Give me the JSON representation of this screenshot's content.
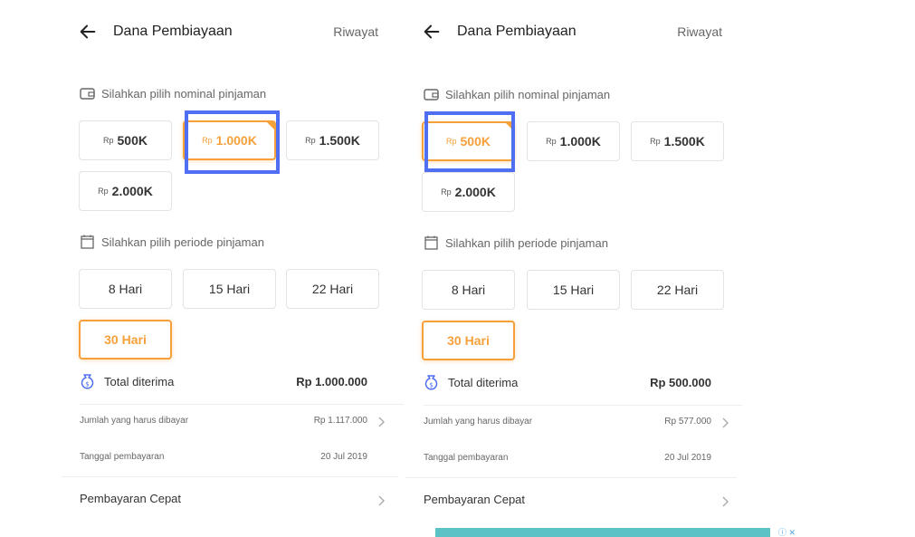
{
  "left": {
    "header": {
      "title": "Dana Pembiayaan",
      "history": "Riwayat"
    },
    "amount_label": "Silahkan pilih nominal pinjaman",
    "currency_prefix": "Rp",
    "amounts": [
      "500K",
      "1.000K",
      "1.500K",
      "2.000K"
    ],
    "selected_amount": "1.000K",
    "period_label": "Silahkan pilih periode pinjaman",
    "periods": [
      "8 Hari",
      "15 Hari",
      "22 Hari",
      "30 Hari"
    ],
    "selected_period": "30 Hari",
    "total_label": "Total diterima",
    "total_value": "Rp 1.000.000",
    "due_label": "Jumlah yang harus dibayar",
    "due_value": "Rp 1.117.000",
    "date_label": "Tanggal pembayaran",
    "date_value": "20 Jul 2019",
    "quick_pay": "Pembayaran Cepat"
  },
  "right": {
    "header": {
      "title": "Dana Pembiayaan",
      "history": "Riwayat"
    },
    "amount_label": "Silahkan pilih nominal pinjaman",
    "currency_prefix": "Rp",
    "amounts": [
      "500K",
      "1.000K",
      "1.500K",
      "2.000K"
    ],
    "selected_amount": "500K",
    "period_label": "Silahkan pilih periode pinjaman",
    "periods": [
      "8 Hari",
      "15 Hari",
      "22 Hari",
      "30 Hari"
    ],
    "selected_period": "30 Hari",
    "total_label": "Total diterima",
    "total_value": "Rp 500.000",
    "due_label": "Jumlah yang harus dibayar",
    "due_value": "Rp 577.000",
    "date_label": "Tanggal pembayaran",
    "date_value": "20 Jul 2019",
    "quick_pay": "Pembayaran Cepat"
  },
  "colors": {
    "accent": "#f6a03a",
    "highlight": "#4f6ef2",
    "ad_bg": "#5dc2c6"
  },
  "icons": [
    "back-arrow-icon",
    "wallet-icon",
    "calendar-icon",
    "money-bag-icon",
    "chevron-right-icon",
    "ad-info-icon",
    "ad-close-icon"
  ]
}
